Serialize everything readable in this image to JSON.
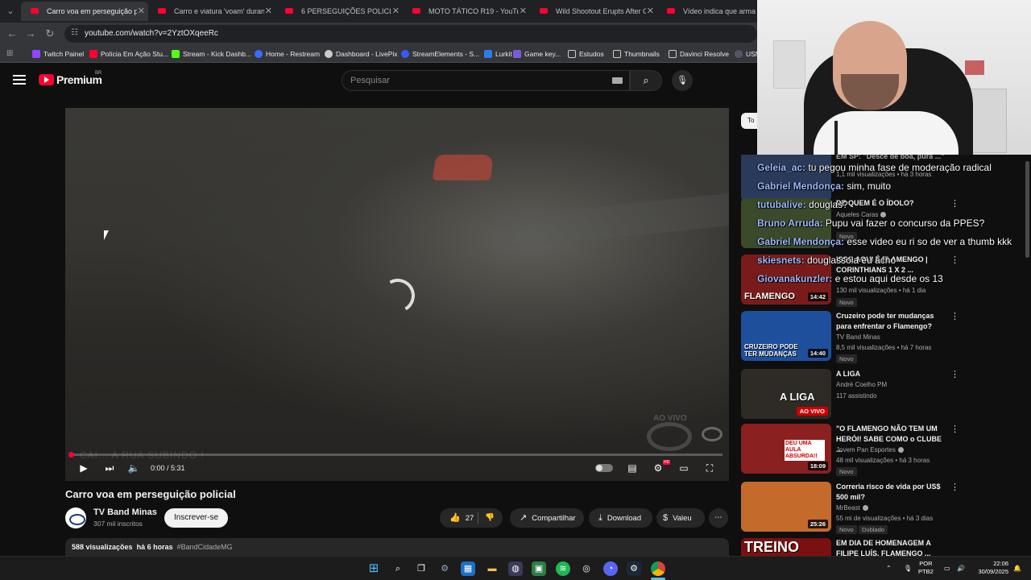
{
  "browser": {
    "tabs": [
      {
        "title": "Carro voa em perseguição polic",
        "active": true
      },
      {
        "title": "Carro e viatura 'voam' durante",
        "active": false
      },
      {
        "title": "6 PERSEGUIÇÕES POLICIAIS MA",
        "active": false
      },
      {
        "title": "MOTO TÁTICO R19 - YouTube",
        "active": false
      },
      {
        "title": "Wild Shootout Erupts After Gu",
        "active": false
      },
      {
        "title": "Vídeo indica que arma foi co",
        "active": false
      }
    ],
    "url": "youtube.com/watch?v=2YztOXqeeRc",
    "bookmarks": [
      {
        "label": "Twitch Painel",
        "color": "#9146ff"
      },
      {
        "label": "Polícia Em Ação Stu...",
        "color": "#ff0033"
      },
      {
        "label": "Stream - Kick Dashb...",
        "color": "#53fc18"
      },
      {
        "label": "Home - Restream",
        "color": "#3d6bff"
      },
      {
        "label": "Dashboard - LivePix",
        "color": "#cccccc"
      },
      {
        "label": "StreamElements - S...",
        "color": "#3a59ff"
      },
      {
        "label": "Lurkit",
        "color": "#2b7de9"
      },
      {
        "label": "Game key...",
        "color": "#7b5cd6"
      },
      {
        "label": "Estudos",
        "color": "folder"
      },
      {
        "label": "Thumbnails",
        "color": "folder"
      },
      {
        "label": "Davinci Resolve",
        "color": "folder"
      },
      {
        "label": "USN",
        "color": "#556"
      }
    ]
  },
  "youtube": {
    "logo_text": "Premium",
    "region": "BR",
    "search_placeholder": "Pesquisar",
    "sidebar_chip": "To"
  },
  "player": {
    "time": "0:00 / 5:31",
    "progress": 0,
    "watermark": "AO VIVO",
    "ghost_text": "CAI... A RUA SUBINDO !",
    "hd_badge": "HD"
  },
  "video": {
    "title": "Carro voa em perseguição policial",
    "channel": "TV Band Minas",
    "subscribers": "307 mil inscritos",
    "subscribe_label": "Inscrever-se",
    "likes": "27",
    "share_label": "Compartilhar",
    "download_label": "Download",
    "thanks_label": "Valeu",
    "views": "588 visualizações",
    "age": "há 6 horas",
    "hashtag": "#BandCidadeMG"
  },
  "related": [
    {
      "title": "EM SP: \"Desce de boa, pura ...\"",
      "channel": "",
      "meta": "1,1 mil visualizações • há 3 horas",
      "duration": "",
      "badge": "",
      "thumb_text": "",
      "thumb_color": "#2a3a5a"
    },
    {
      "title": "DE QUEM É O ÍDOLO?",
      "channel": "Aqueles Caras",
      "meta": "",
      "duration": "",
      "badge": "Novo",
      "thumb_text": "",
      "thumb_color": "#3a4a2a"
    },
    {
      "title": "ISSO AQUI É FLAMENGO | CORINTHIANS 1 X 2 ...",
      "channel": "",
      "meta": "130 mil visualizações • há 1 dia",
      "duration": "14:42",
      "badge": "Novo",
      "thumb_text": "FLAMENGO",
      "thumb_color": "#7a1b1b"
    },
    {
      "title": "Cruzeiro pode ter mudanças para enfrentar o Flamengo?",
      "channel": "TV Band Minas",
      "meta": "8,5 mil visualizações • há 7 horas",
      "duration": "14:40",
      "badge": "Novo",
      "thumb_text": "CRUZEIRO PODE TER MUDANÇAS",
      "thumb_color": "#1d4f9c"
    },
    {
      "title": "A LIGA",
      "channel": "André Coelho PM",
      "meta": "117 assistindo",
      "duration": "",
      "live": "AO VIVO",
      "badge": "",
      "thumb_text": "A LIGA",
      "thumb_color": "#2e2a26"
    },
    {
      "title": "\"O FLAMENGO NÃO TEM UM HERÓI! SABE COMO o CLUBE ...",
      "channel": "Jovem Pan Esportes",
      "meta": "48 mil visualizações • há 3 horas",
      "duration": "18:09",
      "badge": "Novo",
      "thumb_text": "DEU UMA AULA ABSURDA!!",
      "thumb_color": "#8a2020"
    },
    {
      "title": "Correria risco de vida por US$ 500 mil?",
      "channel": "MrBeast",
      "meta": "55 mi de visualizações • há 3 dias",
      "duration": "25:26",
      "badge": "Novo",
      "badge2": "Dublado",
      "thumb_text": "",
      "thumb_color": "#c46a2a"
    },
    {
      "title": "EM DIA DE HOMENAGEM A FILIPE LUÍS, FLAMENGO ...",
      "channel": "",
      "meta": "",
      "duration": "",
      "badge": "",
      "thumb_text": "TREINO",
      "thumb_color": "#7a1010"
    }
  ],
  "chat": [
    {
      "user": "Geleia_ac:",
      "msg": "tu pegou minha fase de moderação radical"
    },
    {
      "user": "Gabriel Mendonça:",
      "msg": "sim, muito"
    },
    {
      "user": "tutubalive:",
      "msg": "douglas?"
    },
    {
      "user": "Bruno Arruda:",
      "msg": "Pupu vai fazer o concurso da PPES?"
    },
    {
      "user": "Gabriel Mendonça:",
      "msg": "esse video eu ri so de ver a thumb kkk"
    },
    {
      "user": "skiesnets:",
      "msg": "douglassola eu acho"
    },
    {
      "user": "Giovanakunzler:",
      "msg": "e estou aqui desde os 13"
    }
  ],
  "taskbar": {
    "lang_top": "POR",
    "lang_bottom": "PTB2",
    "time": "22:06",
    "date": "30/09/2025"
  }
}
